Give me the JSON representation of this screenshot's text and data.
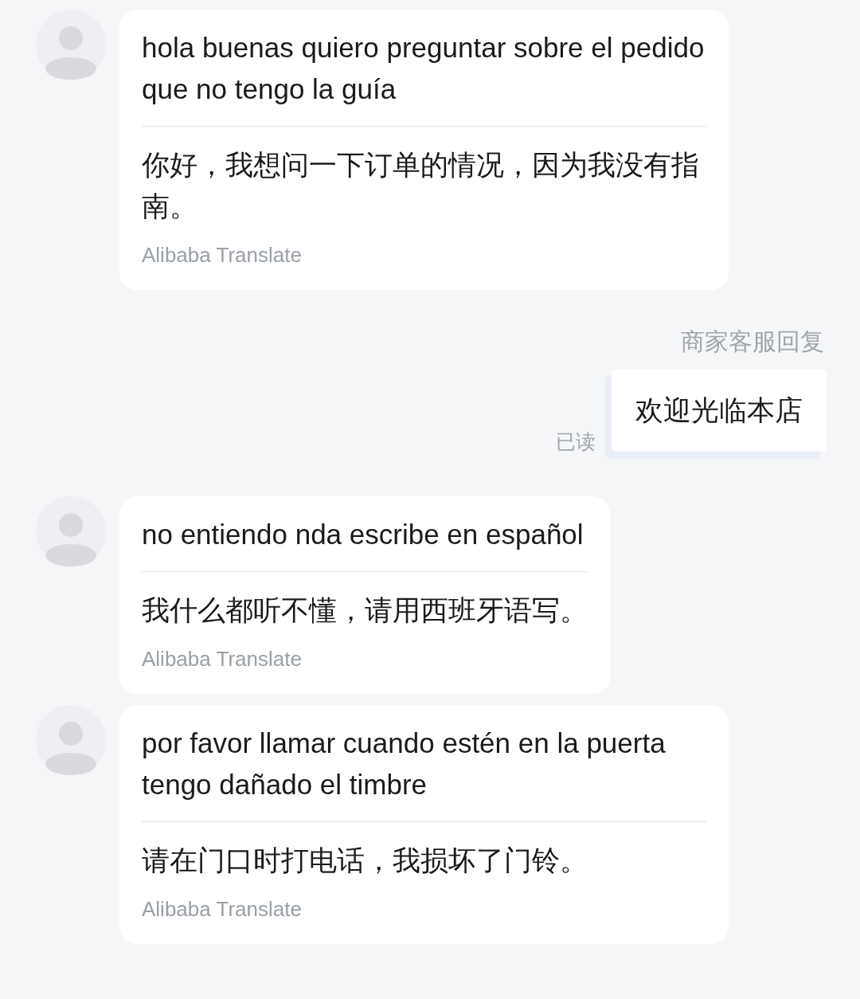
{
  "messages": [
    {
      "kind": "incoming",
      "text": "hola buenas quiero preguntar sobre el pedido que no tengo la guía",
      "translation": "你好，我想问一下订单的情况，因为我没有指南。",
      "translator": "Alibaba Translate"
    },
    {
      "kind": "outgoing",
      "sender": "商家客服回复",
      "text": "欢迎光临本店",
      "read_status": "已读"
    },
    {
      "kind": "incoming",
      "text": "no entiendo nda escribe en español",
      "translation": "我什么都听不懂，请用西班牙语写。",
      "translator": "Alibaba Translate"
    },
    {
      "kind": "incoming",
      "text": "por favor llamar cuando estén en la puerta tengo dañado el timbre",
      "translation": "请在门口时打电话，我损坏了门铃。",
      "translator": "Alibaba Translate"
    }
  ]
}
